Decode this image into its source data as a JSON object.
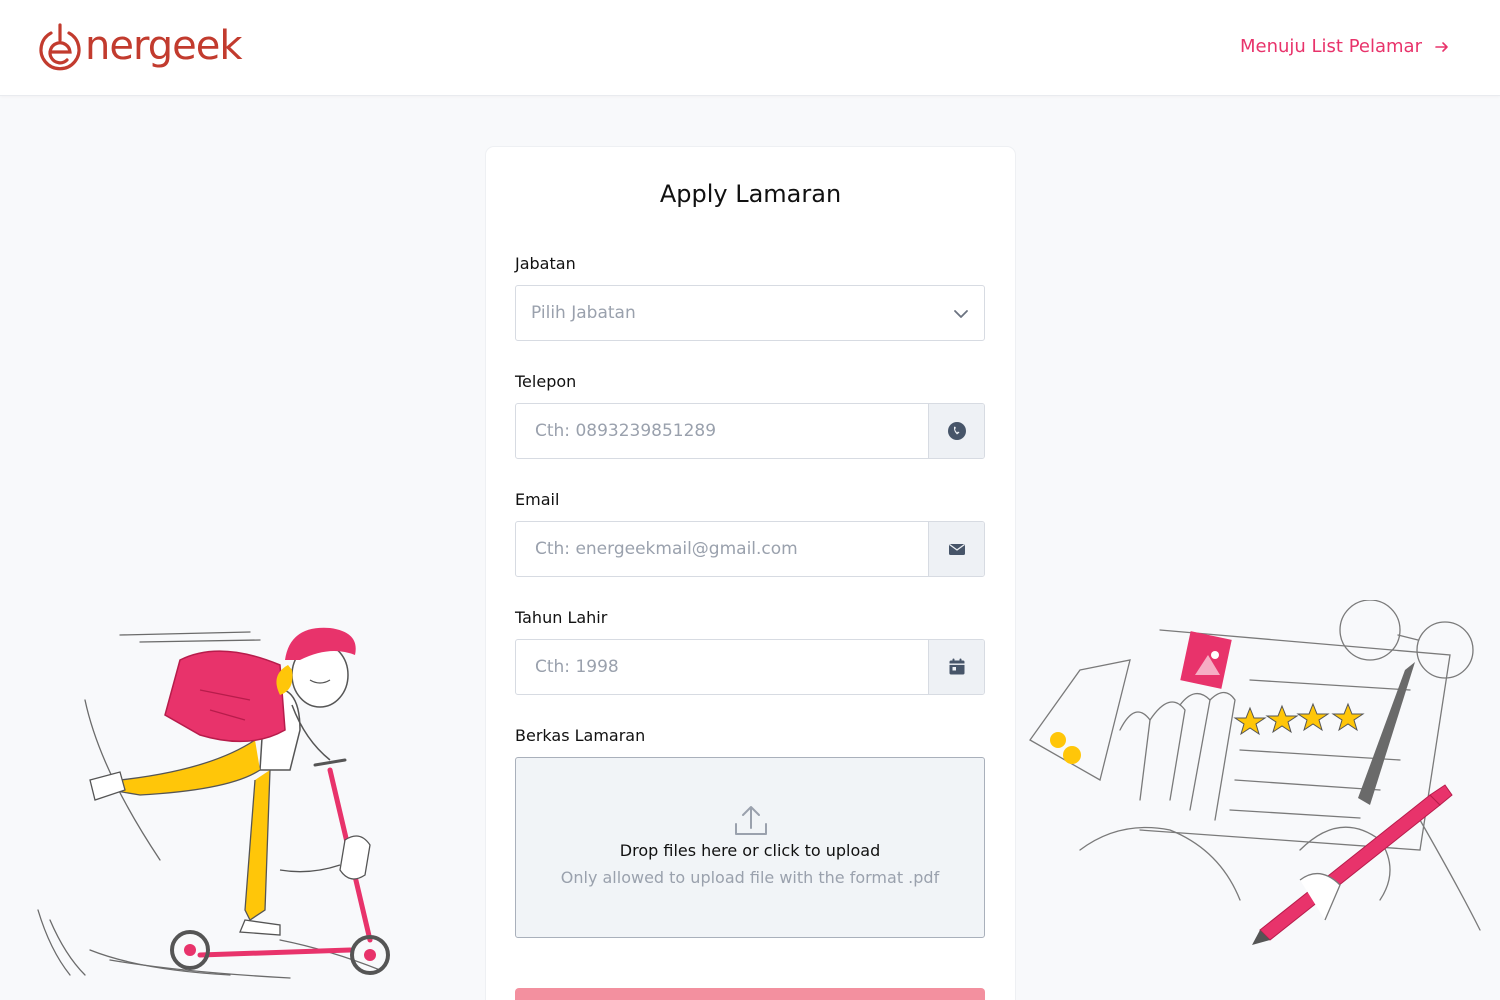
{
  "header": {
    "logo_text": "nergeek",
    "nav_link_label": "Menuju List Pelamar"
  },
  "form": {
    "title": "Apply Lamaran",
    "jabatan": {
      "label": "Jabatan",
      "placeholder": "Pilih Jabatan"
    },
    "telepon": {
      "label": "Telepon",
      "placeholder": "Cth: 0893239851289"
    },
    "email": {
      "label": "Email",
      "placeholder": "Cth: energeekmail@gmail.com"
    },
    "tahun_lahir": {
      "label": "Tahun Lahir",
      "placeholder": "Cth: 1998"
    },
    "berkas": {
      "label": "Berkas Lamaran",
      "drop_title": "Drop files here or click to upload",
      "drop_hint": "Only allowed to upload file with the format .pdf"
    }
  },
  "icons": {
    "phone": "phone-icon",
    "email": "envelope-icon",
    "calendar": "calendar-icon",
    "upload": "upload-icon",
    "dropdown": "chevron-down-icon",
    "arrow": "arrow-right-icon"
  },
  "colors": {
    "brand": "#c23b2e",
    "accent": "#e8336b",
    "submit": "#f3909f",
    "yellow": "#ffc609"
  }
}
